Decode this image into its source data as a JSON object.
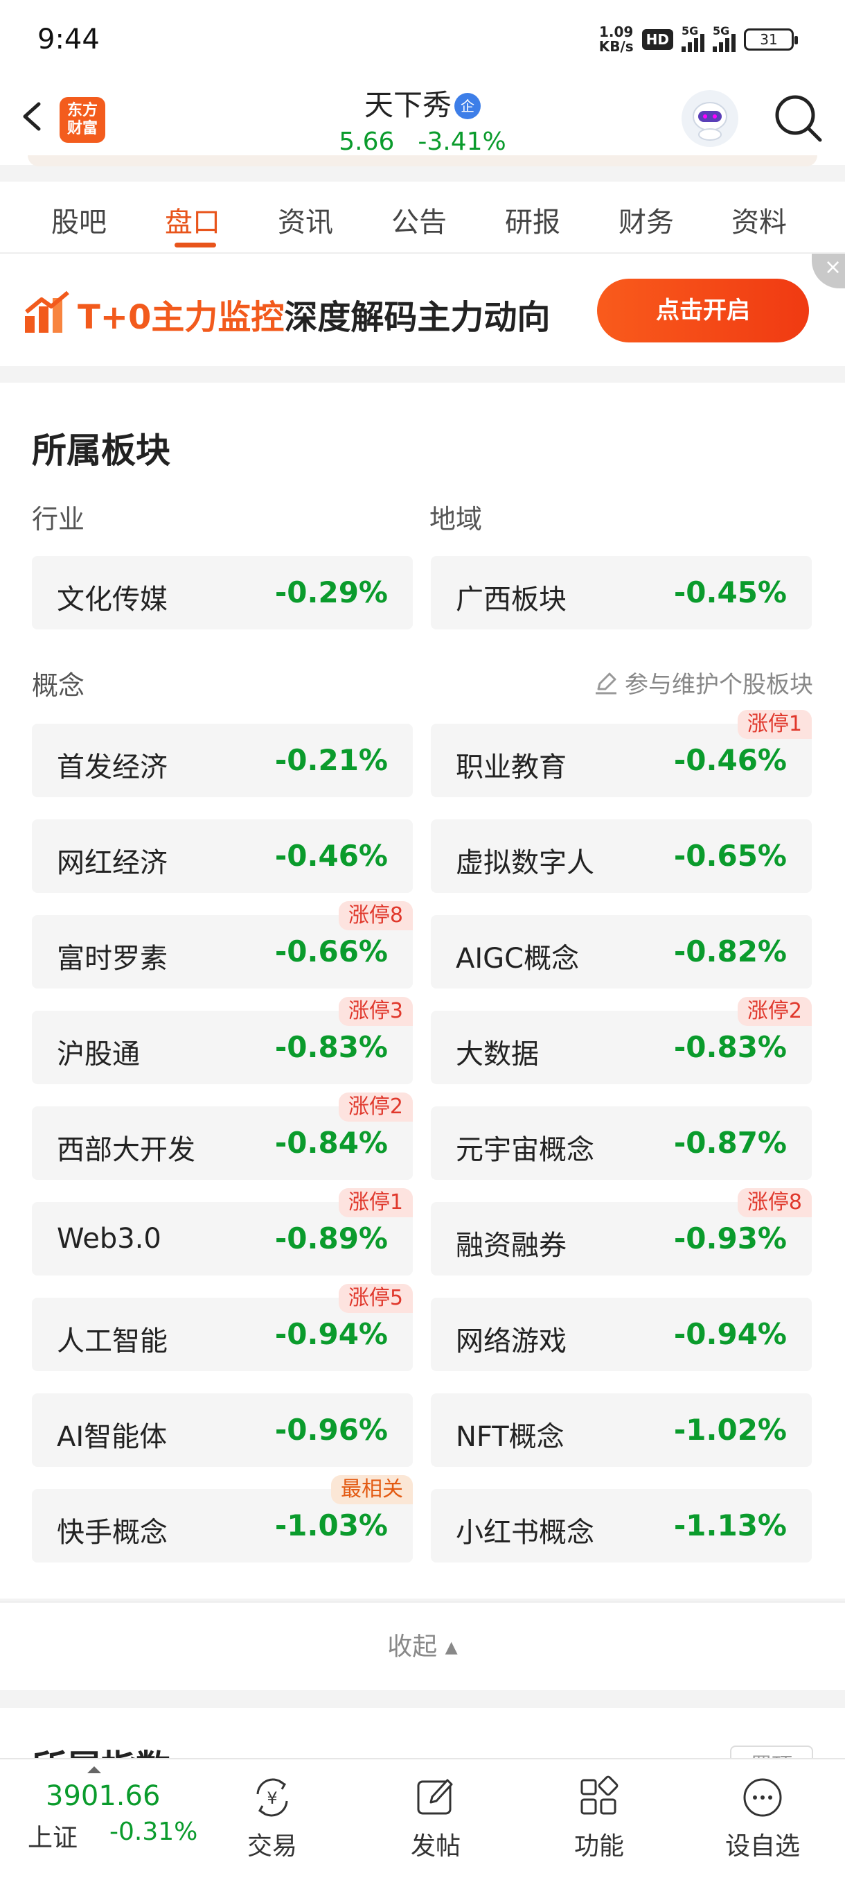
{
  "status_bar": {
    "time": "9:44",
    "speed_value": "1.09",
    "speed_unit": "KB/s",
    "hd": "HD",
    "net1": "5G",
    "net2": "5G",
    "battery": "31"
  },
  "header": {
    "logo_line1": "东方",
    "logo_line2": "财富",
    "stock_name": "天下秀",
    "badge": "企",
    "price": "5.66",
    "change_pct": "-3.41%",
    "quote_color": "#0a9b2c"
  },
  "tabs": [
    {
      "label": "股吧"
    },
    {
      "label": "盘口"
    },
    {
      "label": "资讯"
    },
    {
      "label": "公告"
    },
    {
      "label": "研报"
    },
    {
      "label": "财务"
    },
    {
      "label": "资料"
    }
  ],
  "active_tab": "盘口",
  "banner": {
    "highlight": "T+0主力监控",
    "text": "深度解码主力动向",
    "button": "点击开启",
    "close_icon": "close-icon"
  },
  "sector": {
    "title": "所属板块",
    "industry_label": "行业",
    "region_label": "地域",
    "industry": {
      "name": "文化传媒",
      "pct": "-0.29%"
    },
    "region": {
      "name": "广西板块",
      "pct": "-0.45%"
    },
    "concept_label": "概念",
    "maintain_link": "参与维护个股板块",
    "concepts": [
      {
        "name": "首发经济",
        "pct": "-0.21%",
        "tag": ""
      },
      {
        "name": "职业教育",
        "pct": "-0.46%",
        "tag": "涨停1"
      },
      {
        "name": "网红经济",
        "pct": "-0.46%",
        "tag": ""
      },
      {
        "name": "虚拟数字人",
        "pct": "-0.65%",
        "tag": ""
      },
      {
        "name": "富时罗素",
        "pct": "-0.66%",
        "tag": "涨停8"
      },
      {
        "name": "AIGC概念",
        "pct": "-0.82%",
        "tag": ""
      },
      {
        "name": "沪股通",
        "pct": "-0.83%",
        "tag": "涨停3"
      },
      {
        "name": "大数据",
        "pct": "-0.83%",
        "tag": "涨停2"
      },
      {
        "name": "西部大开发",
        "pct": "-0.84%",
        "tag": "涨停2"
      },
      {
        "name": "元宇宙概念",
        "pct": "-0.87%",
        "tag": ""
      },
      {
        "name": "Web3.0",
        "pct": "-0.89%",
        "tag": "涨停1"
      },
      {
        "name": "融资融券",
        "pct": "-0.93%",
        "tag": "涨停8"
      },
      {
        "name": "人工智能",
        "pct": "-0.94%",
        "tag": "涨停5"
      },
      {
        "name": "网络游戏",
        "pct": "-0.94%",
        "tag": ""
      },
      {
        "name": "AI智能体",
        "pct": "-0.96%",
        "tag": ""
      },
      {
        "name": "NFT概念",
        "pct": "-1.02%",
        "tag": ""
      },
      {
        "name": "快手概念",
        "pct": "-1.03%",
        "tag": "最相关"
      },
      {
        "name": "小红书概念",
        "pct": "-1.13%",
        "tag": ""
      }
    ],
    "collapse": "收起 ▴"
  },
  "next_section": {
    "title": "所属指数",
    "button": "置顶"
  },
  "bottom_bar": {
    "index_value": "3901.66",
    "index_name": "上证",
    "index_pct": "-0.31%",
    "items": [
      {
        "label": "交易",
        "icon": "trade-icon"
      },
      {
        "label": "发帖",
        "icon": "post-icon"
      },
      {
        "label": "功能",
        "icon": "functions-icon"
      },
      {
        "label": "设自选",
        "icon": "more-icon"
      }
    ]
  }
}
